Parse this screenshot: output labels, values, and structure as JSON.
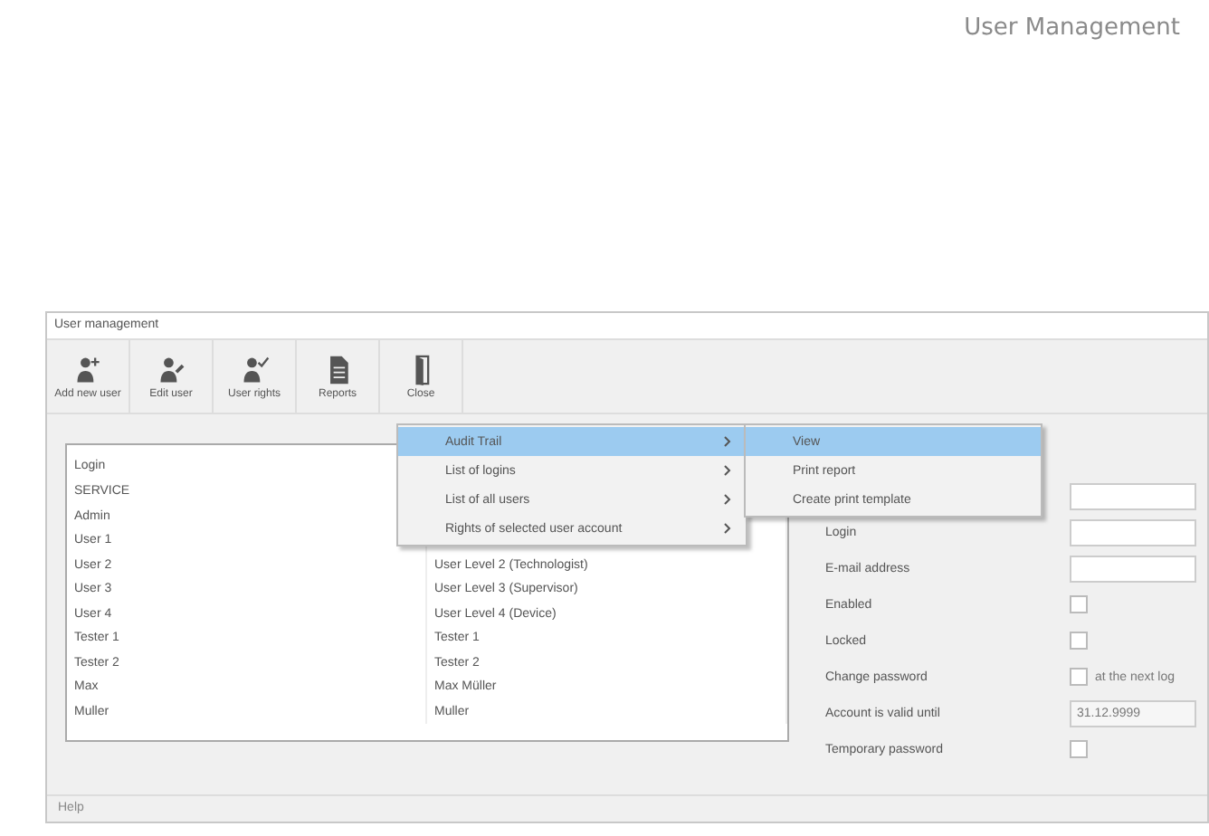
{
  "header": {
    "title": "User Management"
  },
  "window": {
    "title": "User management"
  },
  "toolbar": [
    {
      "label": "Add new user",
      "kind": "user-add"
    },
    {
      "label": "Edit user",
      "kind": "user-edit"
    },
    {
      "label": "User rights",
      "kind": "user-check"
    },
    {
      "label": "Reports",
      "kind": "document"
    },
    {
      "label": "Close",
      "kind": "door"
    }
  ],
  "user_list": {
    "columns": [
      "Login"
    ],
    "rows": [
      {
        "login": "SERVICE"
      },
      {
        "login": "Admin"
      },
      {
        "login": "User 1"
      },
      {
        "login": "User 2",
        "name": "User Level 2 (Technologist)"
      },
      {
        "login": "User 3",
        "name": "User Level 3 (Supervisor)"
      },
      {
        "login": "User 4",
        "name": "User Level 4 (Device)"
      },
      {
        "login": "Tester 1",
        "name": "Tester 1"
      },
      {
        "login": "Tester 2",
        "name": "Tester 2"
      },
      {
        "login": "Max",
        "name": "Max Müller"
      },
      {
        "login": "Muller",
        "name": "Muller"
      }
    ]
  },
  "context_menu": {
    "items": [
      {
        "label": "Audit Trail",
        "selected": true,
        "submenu": true
      },
      {
        "label": "List of logins",
        "selected": false,
        "submenu": true
      },
      {
        "label": "List of all users",
        "selected": false,
        "submenu": true
      },
      {
        "label": "Rights of selected user account",
        "selected": false,
        "submenu": true
      }
    ]
  },
  "submenu": {
    "items": [
      {
        "label": "View",
        "selected": true
      },
      {
        "label": "Print report",
        "selected": false
      },
      {
        "label": "Create print template",
        "selected": false
      }
    ]
  },
  "form": {
    "fields": [
      {
        "kind": "text"
      },
      {
        "kind": "text",
        "label": "Login"
      },
      {
        "kind": "text",
        "label": "E-mail address"
      },
      {
        "kind": "check",
        "label": "Enabled",
        "checked": false
      },
      {
        "kind": "check",
        "label": "Locked",
        "checked": false
      },
      {
        "kind": "check",
        "label": "Change password",
        "checked": false,
        "note": "at the next log"
      },
      {
        "kind": "date",
        "label": "Account is valid until",
        "value": "31.12.9999"
      },
      {
        "kind": "check",
        "label": "Temporary password",
        "checked": false
      }
    ]
  },
  "status_bar": {
    "text": "Help"
  }
}
